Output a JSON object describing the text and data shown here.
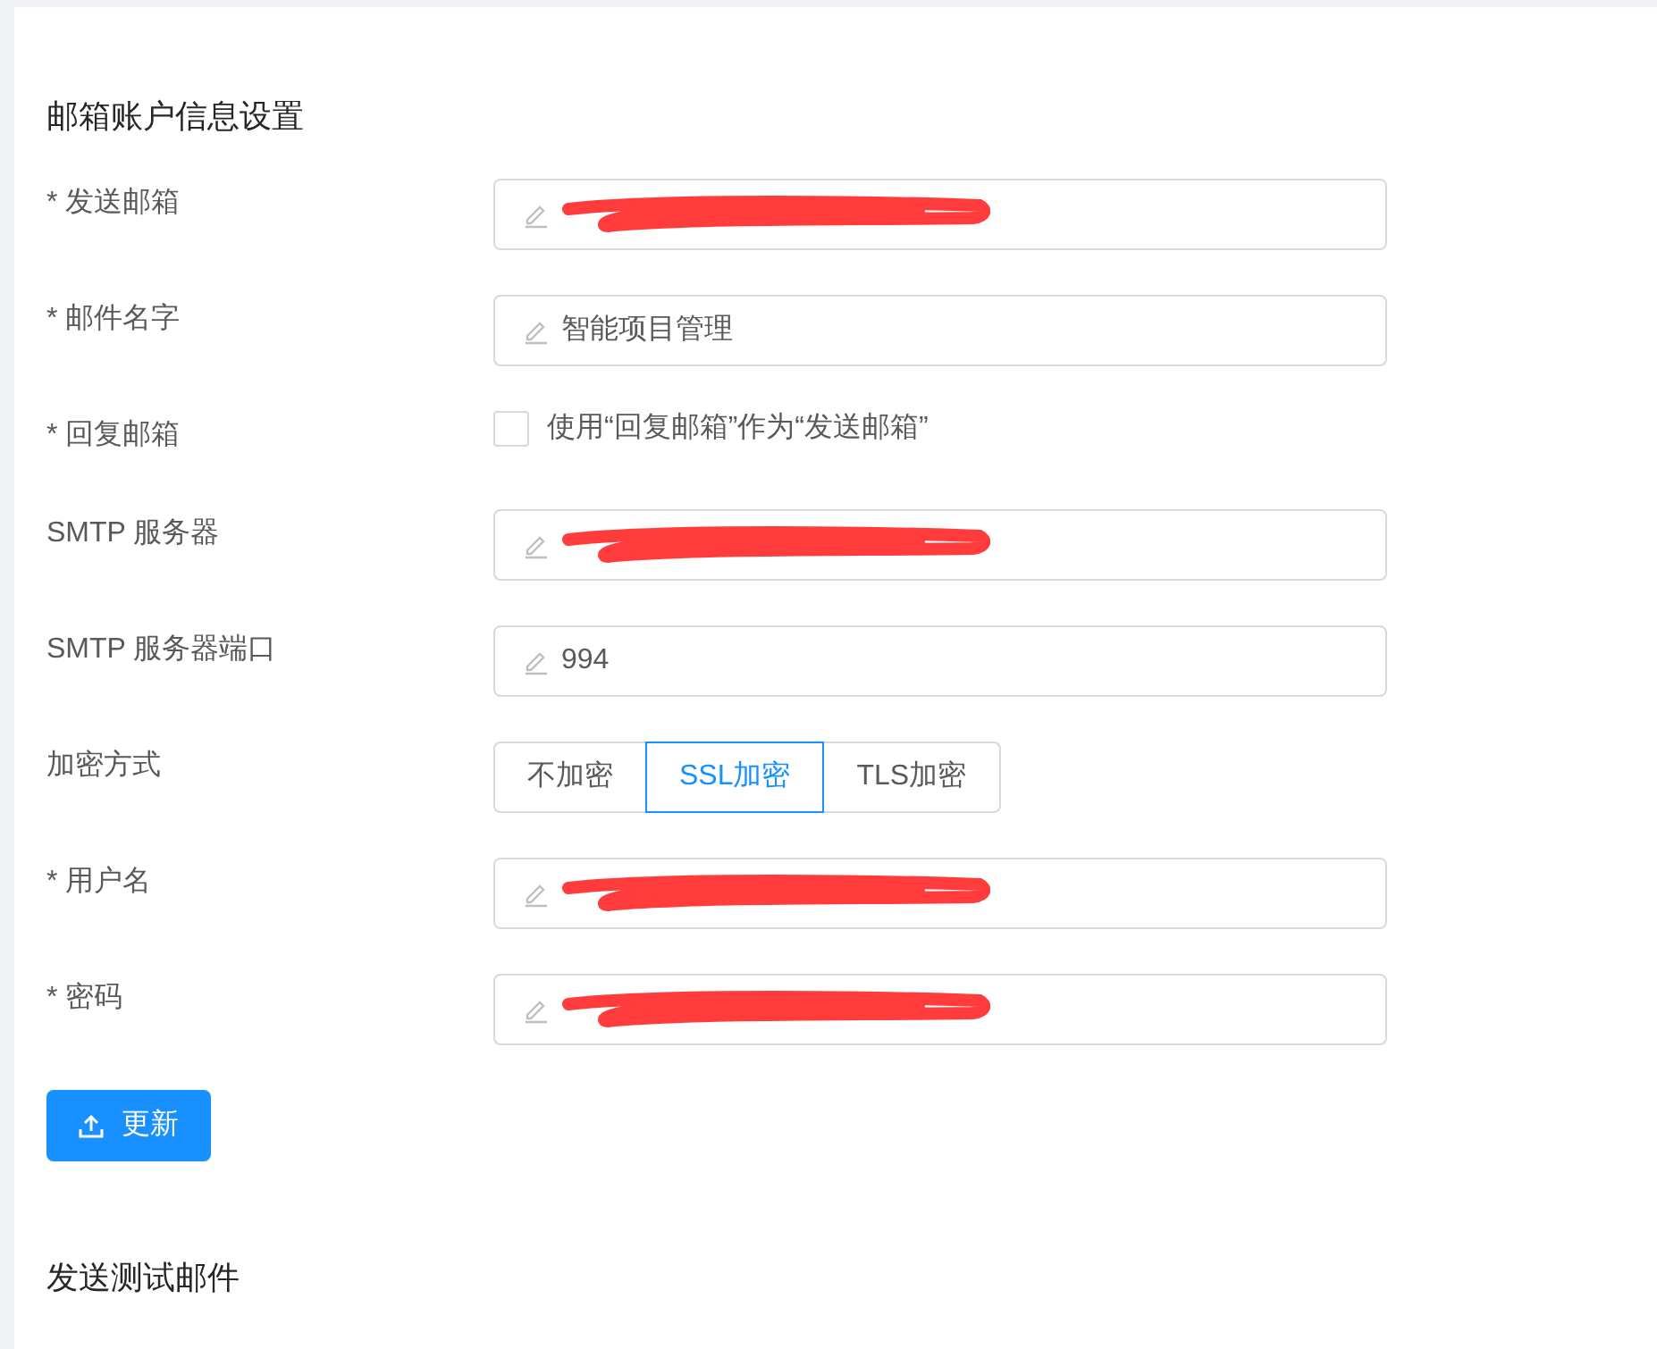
{
  "section_title": "邮箱账户信息设置",
  "fields": [
    {
      "kind": "input",
      "label": "* 发送邮箱",
      "redacted": true
    },
    {
      "kind": "input",
      "label": "* 邮件名字",
      "value": "智能项目管理",
      "redacted": false
    },
    {
      "kind": "checkbox",
      "label": "* 回复邮箱",
      "text": "使用“回复邮箱”作为“发送邮箱”",
      "checked": false
    },
    {
      "kind": "input",
      "label": "SMTP 服务器",
      "redacted": true
    },
    {
      "kind": "input",
      "label": "SMTP 服务器端口",
      "value": "994",
      "redacted": false
    },
    {
      "kind": "segmented",
      "label": "加密方式",
      "options": [
        {
          "label": "不加密",
          "selected": false
        },
        {
          "label": "SSL加密",
          "selected": true
        },
        {
          "label": "TLS加密",
          "selected": false
        }
      ]
    },
    {
      "kind": "input",
      "label": "* 用户名",
      "redacted": true
    },
    {
      "kind": "input",
      "label": "* 密码",
      "redacted": true
    }
  ],
  "update_button": "更新",
  "next_section_title": "发送测试邮件"
}
